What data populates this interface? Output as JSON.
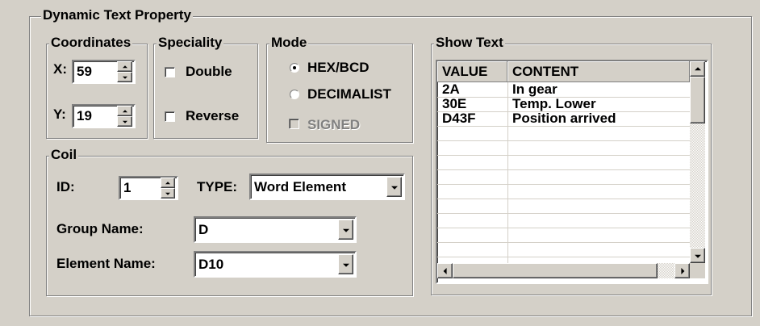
{
  "dynamic_text_property": {
    "title": "Dynamic Text Property",
    "coordinates": {
      "title": "Coordinates",
      "x_label": "X:",
      "x_value": "59",
      "y_label": "Y:",
      "y_value": "19"
    },
    "speciality": {
      "title": "Speciality",
      "double_label": "Double",
      "double_checked": false,
      "reverse_label": "Reverse",
      "reverse_checked": false
    },
    "mode": {
      "title": "Mode",
      "options": [
        "HEX/BCD",
        "DECIMALIST"
      ],
      "selected": "HEX/BCD",
      "signed_label": "SIGNED",
      "signed_enabled": false
    },
    "coil": {
      "title": "Coil",
      "id_label": "ID:",
      "id_value": "1",
      "type_label": "TYPE:",
      "type_value": "Word Element",
      "group_name_label": "Group Name:",
      "group_name_value": "D",
      "element_name_label": "Element Name:",
      "element_name_value": "D10"
    },
    "show_text": {
      "title": "Show Text",
      "columns": [
        "VALUE",
        "CONTENT"
      ],
      "rows": [
        {
          "value": "2A",
          "content": "In gear"
        },
        {
          "value": "30E",
          "content": "Temp. Lower"
        },
        {
          "value": "D43F",
          "content": "Position arrived"
        },
        {
          "value": "",
          "content": ""
        },
        {
          "value": "",
          "content": ""
        },
        {
          "value": "",
          "content": ""
        },
        {
          "value": "",
          "content": ""
        },
        {
          "value": "",
          "content": ""
        },
        {
          "value": "",
          "content": ""
        },
        {
          "value": "",
          "content": ""
        }
      ]
    }
  },
  "colors": {
    "face": "#d4d0c8",
    "shadow": "#808080",
    "highlight": "#ffffff",
    "field_bg": "#ffffff"
  }
}
